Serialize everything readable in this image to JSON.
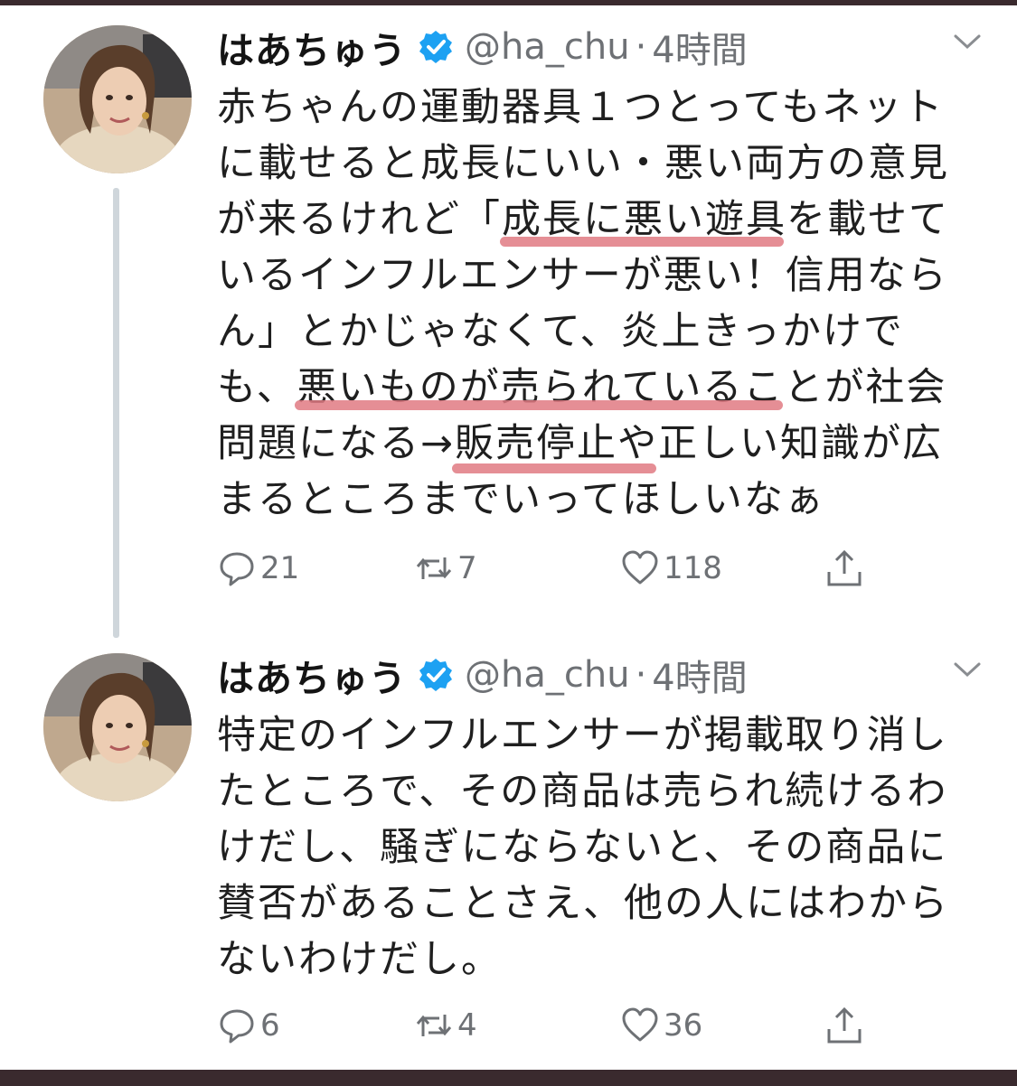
{
  "colors": {
    "frame": "#3a2a2e",
    "verified": "#1da1f2",
    "muted": "#6e7175",
    "highlight": "#e07a82"
  },
  "tweets": [
    {
      "name": "はあちゅう",
      "handle": "@ha_chu",
      "separator": "·",
      "time": "4時間",
      "lines": [
        "赤ちゃんの運動器具１つとってもネット",
        "に載せると成長にいい・悪い両方の意見",
        "が来るけれど「成長に悪い遊具を載せて",
        "いるインフルエンサーが悪い！信用なら",
        "ん」とかじゃなくて、炎上きっかけで",
        "も、悪いものが売られていることが社会",
        "問題になる→販売停止や正しい知識が広",
        "まるところまでいってほしいなぁ"
      ],
      "replies": "21",
      "retweets": "7",
      "likes": "118",
      "icons": [
        "reply-icon",
        "retweet-icon",
        "like-icon",
        "share-icon",
        "verified-badge-icon",
        "chevron-down-icon"
      ]
    },
    {
      "name": "はあちゅう",
      "handle": "@ha_chu",
      "separator": "·",
      "time": "4時間",
      "lines": [
        "特定のインフルエンサーが掲載取り消し",
        "たところで、その商品は売られ続けるわ",
        "けだし、騒ぎにならないと、その商品に",
        "賛否があることさえ、他の人にはわから",
        "ないわけだし。"
      ],
      "replies": "6",
      "retweets": "4",
      "likes": "36",
      "icons": [
        "reply-icon",
        "retweet-icon",
        "like-icon",
        "share-icon",
        "verified-badge-icon",
        "chevron-down-icon"
      ]
    }
  ]
}
